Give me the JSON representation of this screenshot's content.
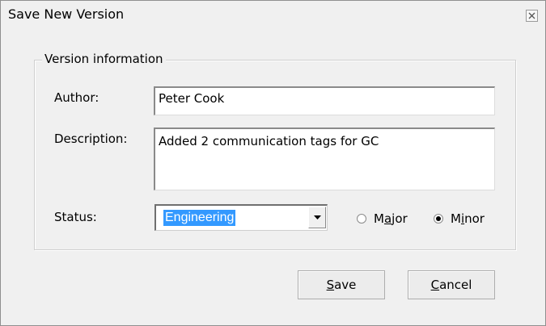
{
  "window": {
    "title": "Save New Version"
  },
  "group": {
    "legend": "Version information"
  },
  "fields": {
    "author_label": "Author:",
    "author_value": "Peter Cook",
    "description_label": "Description:",
    "description_value": "Added 2 communication tags for GC",
    "status_label": "Status:",
    "status_value": "Engineering"
  },
  "radios": {
    "major": {
      "before": "M",
      "access_key": "a",
      "after": "jor",
      "selected": false
    },
    "minor": {
      "before": "M",
      "access_key": "i",
      "after": "nor",
      "selected": true
    }
  },
  "buttons": {
    "save": {
      "access_key": "S",
      "rest": "ave"
    },
    "cancel": {
      "access_key": "C",
      "rest": "ancel"
    }
  },
  "icons": {
    "close": "close-icon",
    "dropdown": "chevron-down-icon"
  }
}
